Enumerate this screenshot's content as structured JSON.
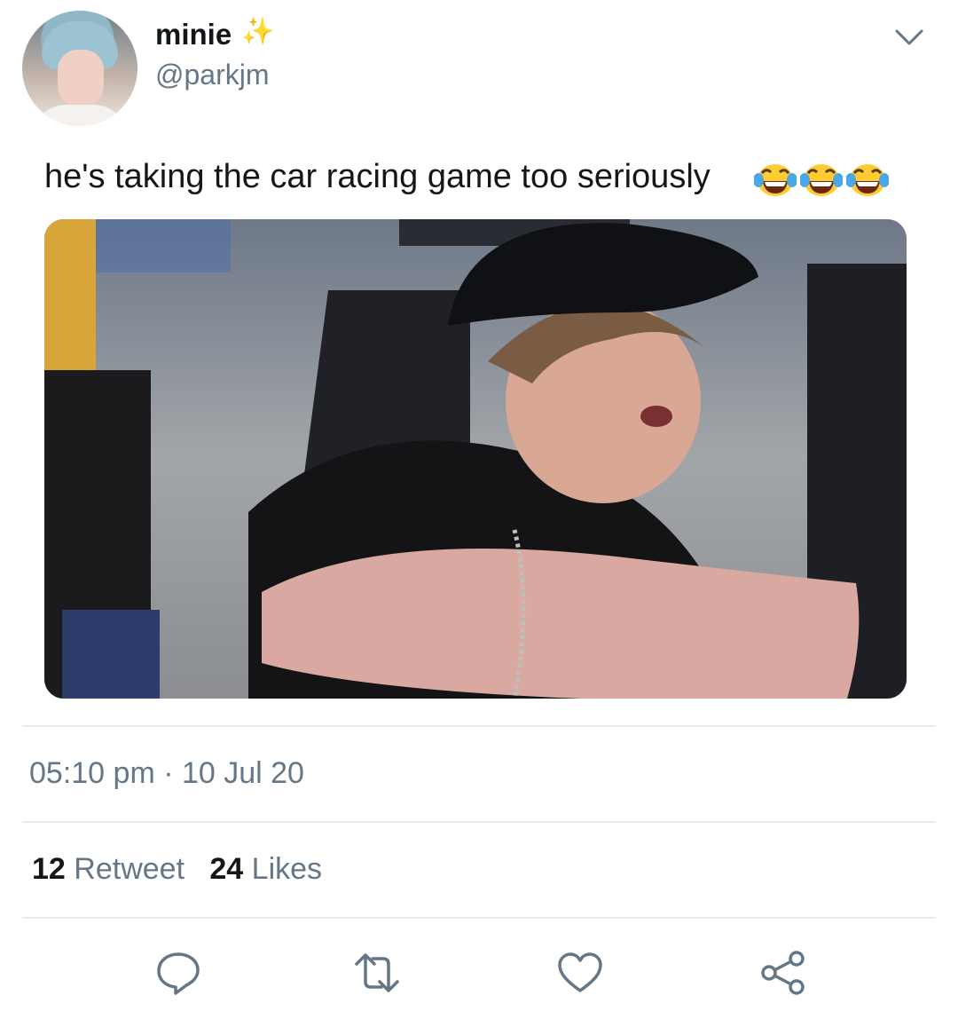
{
  "header": {
    "display_name": "minie",
    "handle": "@parkjm",
    "sparkles_emoji": "✨"
  },
  "tweet": {
    "text": "he's taking the car racing game too seriously",
    "emojis": [
      "😂",
      "😂",
      "😂"
    ],
    "timestamp": "05:10 pm · 10 Jul 20"
  },
  "stats": {
    "retweets_count": "12",
    "retweets_label": "Retweet",
    "likes_count": "24",
    "likes_label": "Likes"
  },
  "actions": [
    "reply-icon",
    "retweet-icon",
    "like-icon",
    "share-icon"
  ],
  "colors": {
    "text": "#14171a",
    "secondary": "#657786",
    "divider": "#e6ecf0",
    "icon": "#657786"
  }
}
